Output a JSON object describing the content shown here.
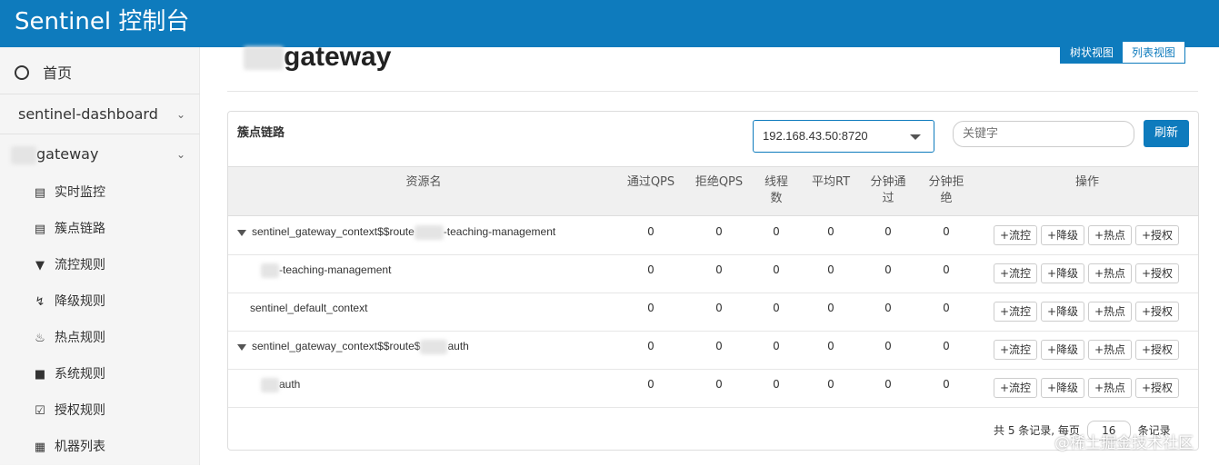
{
  "app": {
    "title": "Sentinel 控制台"
  },
  "sidebar": {
    "home": "首页",
    "dashboard": "sentinel-dashboard",
    "app_name": "gateway",
    "items": [
      {
        "label": "实时监控",
        "icon": "bar-chart-icon"
      },
      {
        "label": "簇点链路",
        "icon": "list-icon"
      },
      {
        "label": "流控规则",
        "icon": "filter-icon"
      },
      {
        "label": "降级规则",
        "icon": "bolt-icon"
      },
      {
        "label": "热点规则",
        "icon": "fire-icon"
      },
      {
        "label": "系统规则",
        "icon": "lock-icon"
      },
      {
        "label": "授权规则",
        "icon": "check-icon"
      },
      {
        "label": "机器列表",
        "icon": "grid-icon"
      }
    ]
  },
  "main": {
    "title": "gateway",
    "view_tree": "树状视图",
    "view_list": "列表视图",
    "panel_title": "簇点链路",
    "machine": "192.168.43.50:8720",
    "search_placeholder": "关键字",
    "refresh": "刷新"
  },
  "table": {
    "headers": {
      "resource": "资源名",
      "pass_qps": "通过QPS",
      "block_qps": "拒绝QPS",
      "threads": "线程数",
      "avg_rt": "平均RT",
      "minute_pass": "分钟通过",
      "minute_block": "分钟拒绝",
      "ops": "操作"
    },
    "rows": [
      {
        "prefix": "sentinel_gateway_context$$route",
        "suffix": "-teaching-management",
        "expanded": true,
        "values": [
          "0",
          "0",
          "0",
          "0",
          "0",
          "0"
        ]
      },
      {
        "prefix": "",
        "suffix": "-teaching-management",
        "expanded": false,
        "values": [
          "0",
          "0",
          "0",
          "0",
          "0",
          "0"
        ]
      },
      {
        "prefix": "sentinel_default_context",
        "suffix": "",
        "expanded": false,
        "values": [
          "0",
          "0",
          "0",
          "0",
          "0",
          "0"
        ]
      },
      {
        "prefix": "sentinel_gateway_context$$route$",
        "suffix": "auth",
        "expanded": true,
        "values": [
          "0",
          "0",
          "0",
          "0",
          "0",
          "0"
        ]
      },
      {
        "prefix": "",
        "suffix": "auth",
        "expanded": false,
        "values": [
          "0",
          "0",
          "0",
          "0",
          "0",
          "0"
        ]
      }
    ],
    "op_labels": {
      "flow": "+流控",
      "degrade": "+降级",
      "hot": "+热点",
      "auth": "+授权"
    }
  },
  "pager": {
    "prefix": "共 5 条记录, 每页",
    "page_size": "16",
    "suffix": "条记录"
  },
  "watermark": "@稀土掘金技术社区",
  "colors": {
    "primary": "#0e7bbd"
  }
}
